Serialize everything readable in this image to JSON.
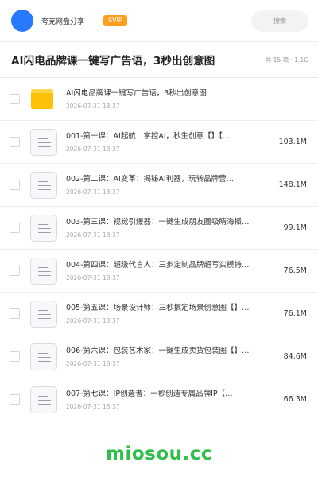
{
  "header": {
    "share_name": "夸克网盘分享",
    "badge": "SVIP",
    "search_placeholder": "搜索"
  },
  "folder": {
    "title": "AI闪电品牌课一键写广告语，3秒出创意图",
    "meta": "共 15 项 · 1.1G"
  },
  "files": [
    {
      "type": "folder",
      "name": "AI闪电品牌课一键写广告语，3秒出创意图",
      "date": "2026-07-31 18:37",
      "size": ""
    },
    {
      "type": "doc",
      "name": "001-第一课：AI起航：掌控AI，秒生创意【】【…",
      "date": "2026-07-31 18:37",
      "size": "103.1M"
    },
    {
      "type": "doc",
      "name": "002-第二课：AI变革：揭秘AI利器，玩转品牌营…",
      "date": "2026-07-31 18:37",
      "size": "148.1M"
    },
    {
      "type": "doc",
      "name": "003-第三课：视觉引爆器：一键生成朋友圈吸睛海报…",
      "date": "2026-07-31 18:37",
      "size": "99.1M"
    },
    {
      "type": "doc",
      "name": "004-第四课：超级代言人：三步定制品牌超写实模特…",
      "date": "2026-07-31 18:37",
      "size": "76.5M"
    },
    {
      "type": "doc",
      "name": "005-第五课：场景设计师：三秒搞定场景创意图【】…",
      "date": "2026-07-31 18:37",
      "size": "76.1M"
    },
    {
      "type": "doc",
      "name": "006-第六课：包装艺术家：一键生成卖货包装图【】…",
      "date": "2026-07-31 18:37",
      "size": "84.6M"
    },
    {
      "type": "doc",
      "name": "007-第七课：IP创造者：一秒创造专属品牌IP【…",
      "date": "2026-07-31 18:37",
      "size": "66.3M"
    }
  ],
  "watermark": "miosou.cc",
  "colors": {
    "avatar": "#2979ff",
    "svip": "#ff9d1f",
    "folder": "#ffc107",
    "watermark": "#2fbf4a"
  }
}
